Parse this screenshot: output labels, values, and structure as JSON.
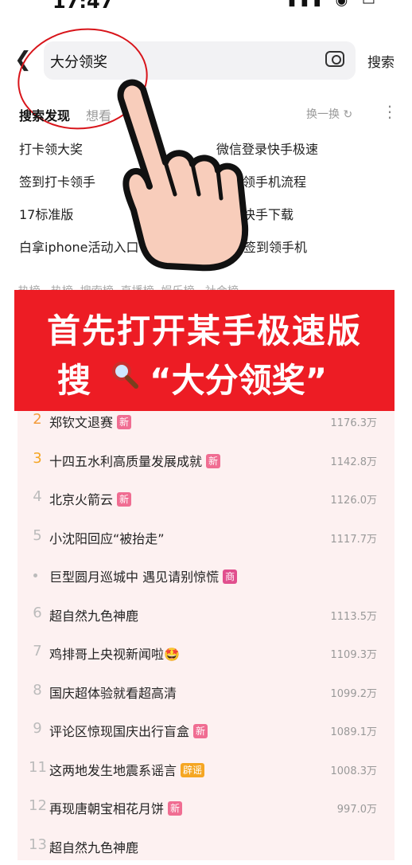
{
  "status": {
    "time": "17:47"
  },
  "search": {
    "query": "大分领奖",
    "button": "搜索"
  },
  "discover": {
    "title": "搜索发现",
    "tab2": "想看",
    "refresh": "换一换",
    "suggestions": [
      "打卡领大奖",
      "微信登录快手极速",
      "签到打卡领手",
      "领手机流程",
      "17标准版",
      "快手下载",
      "白拿iphone活动入口",
      "日签到领手机"
    ]
  },
  "hot_strip": "·热榜 · 热榜 ·搜索榜 ·直播榜 ·娱乐榜 · 社会榜",
  "banner": {
    "line1": "首先打开某手极速版",
    "line2a": "搜",
    "line2b": "“大分领奖”"
  },
  "colors": {
    "banner": "#ed1c24",
    "tag_new": "#f06d92",
    "tag_ad": "#e14f8e",
    "tag_rumor": "#f5a623",
    "circle": "#d8141a"
  },
  "hot_list": [
    {
      "rank": "2",
      "title": "郑钦文退赛",
      "tag": "新",
      "heat": "1176.3万"
    },
    {
      "rank": "3",
      "title": "十四五水利高质量发展成就",
      "tag": "新",
      "heat": "1142.8万"
    },
    {
      "rank": "4",
      "title": "北京火箭云",
      "tag": "新",
      "heat": "1126.0万"
    },
    {
      "rank": "5",
      "title": "小沈阳回应“被抬走”",
      "tag": "",
      "heat": "1117.7万"
    },
    {
      "rank": "",
      "title": "巨型圆月巡城中 遇见请别惊慌",
      "tag": "商",
      "heat": ""
    },
    {
      "rank": "6",
      "title": "超自然九色神鹿",
      "tag": "",
      "heat": "1113.5万"
    },
    {
      "rank": "7",
      "title": "鸡排哥上央视新闻啦🤩",
      "tag": "",
      "heat": "1109.3万"
    },
    {
      "rank": "8",
      "title": "国庆超体验就看超高清",
      "tag": "",
      "heat": "1099.2万"
    },
    {
      "rank": "9",
      "title": "评论区惊现国庆出行盲盒",
      "tag": "新",
      "heat": "1089.1万"
    },
    {
      "rank": "11",
      "title": "这两地发生地震系谣言",
      "tag": "辟谣",
      "heat": "1008.3万"
    },
    {
      "rank": "12",
      "title": "再现唐朝宝相花月饼",
      "tag": "新",
      "heat": "997.0万"
    },
    {
      "rank": "13",
      "title": "超自然九色神鹿",
      "tag": "",
      "heat": ""
    }
  ]
}
